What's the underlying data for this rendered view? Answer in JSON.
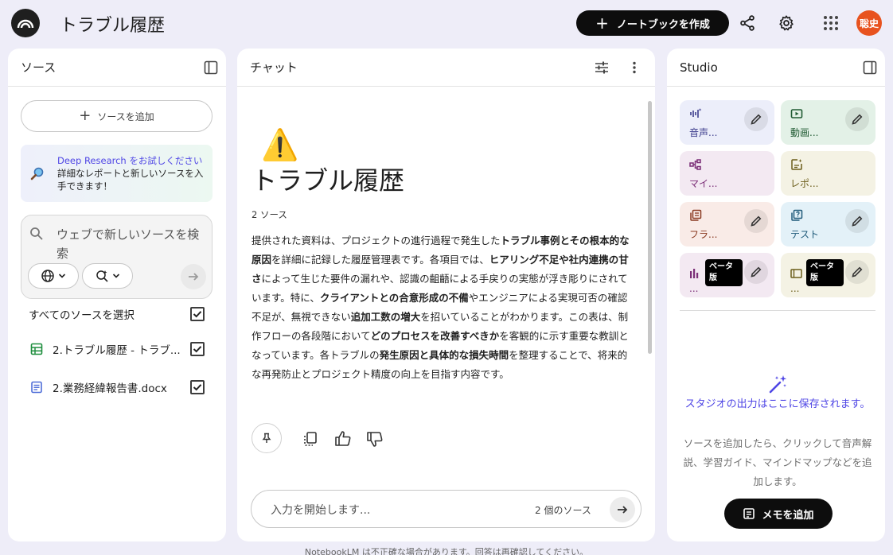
{
  "header": {
    "title": "トラブル履歴",
    "create_label": "ノートブックを作成",
    "avatar_text": "聡史",
    "avatar_color": "#e8531f"
  },
  "sources": {
    "title": "ソース",
    "add_label": "ソースを追加",
    "deep_research": {
      "link_text": "Deep Research をお試しください",
      "text": "詳細なレポートと新しいソースを入手できます！"
    },
    "web_search_placeholder": "ウェブで新しいソースを検索",
    "select_all_label": "すべてのソースを選択",
    "items": [
      {
        "name": "2.トラブル履歴 - トラブ...",
        "icon": "spreadsheet-icon",
        "checked": true
      },
      {
        "name": "2.業務経緯報告書.docx",
        "icon": "document-icon",
        "checked": true
      }
    ]
  },
  "chat": {
    "title": "チャット",
    "emoji": "⚠️",
    "notebook_title": "トラブル履歴",
    "source_count": "2 ソース",
    "input_placeholder": "入力を開始します...",
    "input_source_count": "2 個のソース"
  },
  "studio": {
    "title": "Studio",
    "tiles": [
      {
        "label": "音声...",
        "icon": "audio-icon",
        "bg": "#eceefa",
        "color": "#3c3c8c"
      },
      {
        "label": "動画...",
        "icon": "video-icon",
        "bg": "#e3f1e7",
        "color": "#1f5a32"
      },
      {
        "label": "マイ...",
        "icon": "mindmap-icon",
        "bg": "#f3e9f2",
        "color": "#7b2e77"
      },
      {
        "label": "レポ...",
        "icon": "report-icon",
        "bg": "#f4f2e4",
        "color": "#6b5d1a"
      },
      {
        "label": "フラ...",
        "icon": "flashcard-icon",
        "bg": "#f9ebe7",
        "color": "#8a3b22"
      },
      {
        "label": "テスト",
        "icon": "quiz-icon",
        "bg": "#e3f1f8",
        "color": "#1f5a7a"
      },
      {
        "label": "...",
        "icon": "infographic-icon",
        "bg": "#f3e9f2",
        "color": "#7b2e77",
        "beta": "ベータ版"
      },
      {
        "label": "...",
        "icon": "slides-icon",
        "bg": "#f4f2e4",
        "color": "#6b5d1a",
        "beta": "ベータ版"
      }
    ],
    "empty_title": "スタジオの出力はここに保存されます。",
    "empty_desc": "ソースを追加したら、クリックして音声解説、学習ガイド、マインドマップなどを追加します。",
    "memo_label": "メモを追加"
  },
  "footer": "NotebookLM は不正確な場合があります。回答は再確認してください。"
}
